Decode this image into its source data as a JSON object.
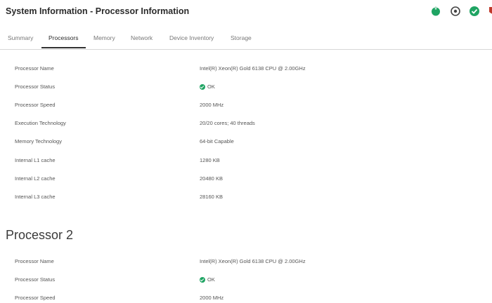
{
  "header": {
    "title": "System Information - Processor Information",
    "icons": [
      "power-icon",
      "target-icon",
      "health-ok-icon",
      "shield-icon"
    ],
    "colors": {
      "power": "#1fa463",
      "ok": "#1fa463",
      "shield": "#c0392b"
    }
  },
  "tabs": [
    {
      "label": "Summary",
      "active": false
    },
    {
      "label": "Processors",
      "active": true
    },
    {
      "label": "Memory",
      "active": false
    },
    {
      "label": "Network",
      "active": false
    },
    {
      "label": "Device Inventory",
      "active": false
    },
    {
      "label": "Storage",
      "active": false
    }
  ],
  "processor1": {
    "rows": [
      {
        "label": "Processor Name",
        "value": "Intel(R) Xeon(R) Gold 6138 CPU @ 2.00GHz"
      },
      {
        "label": "Processor Status",
        "value": "OK",
        "status": "ok"
      },
      {
        "label": "Processor Speed",
        "value": "2000 MHz"
      },
      {
        "label": "Execution Technology",
        "value": "20/20 cores; 40 threads"
      },
      {
        "label": "Memory Technology",
        "value": "64-bit Capable"
      },
      {
        "label": "Internal L1 cache",
        "value": "1280 KB"
      },
      {
        "label": "Internal L2 cache",
        "value": "20480 KB"
      },
      {
        "label": "Internal L3 cache",
        "value": "28160 KB"
      }
    ]
  },
  "processor2": {
    "title": "Processor 2",
    "rows": [
      {
        "label": "Processor Name",
        "value": "Intel(R) Xeon(R) Gold 6138 CPU @ 2.00GHz"
      },
      {
        "label": "Processor Status",
        "value": "OK",
        "status": "ok"
      },
      {
        "label": "Processor Speed",
        "value": "2000 MHz"
      }
    ]
  }
}
